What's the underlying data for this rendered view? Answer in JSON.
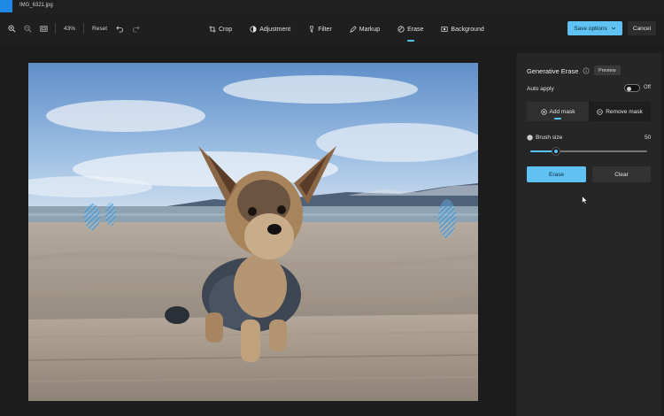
{
  "window": {
    "file_title": "IMG_6321.jpg"
  },
  "toolbar": {
    "zoom_in_icon": "zoom-in-icon",
    "zoom_out_icon": "zoom-out-icon",
    "fit_icon": "fit-to-window-icon",
    "zoom_level": "43%",
    "reset_label": "Reset",
    "undo_icon": "undo-icon",
    "redo_icon": "redo-icon",
    "tools": [
      {
        "label": "Crop",
        "icon": "crop-icon"
      },
      {
        "label": "Adjustment",
        "icon": "adjustment-icon"
      },
      {
        "label": "Filter",
        "icon": "filter-icon"
      },
      {
        "label": "Markup",
        "icon": "markup-icon"
      },
      {
        "label": "Erase",
        "icon": "erase-icon",
        "active": true
      },
      {
        "label": "Background",
        "icon": "background-icon"
      }
    ],
    "save_options_label": "Save options",
    "cancel_label": "Cancel"
  },
  "panel": {
    "title": "Generative Erase",
    "preview_label": "Preview",
    "auto_apply_label": "Auto apply",
    "auto_apply_state": "Off",
    "add_mask_label": "Add mask",
    "remove_mask_label": "Remove mask",
    "brush_size_label": "Brush size",
    "brush_size_value": "50",
    "brush_size_fraction": 0.22,
    "erase_label": "Erase",
    "clear_label": "Clear"
  },
  "colors": {
    "accent": "#5fc2f2",
    "panel_bg": "#262626",
    "app_bg": "#1c1c1c"
  }
}
